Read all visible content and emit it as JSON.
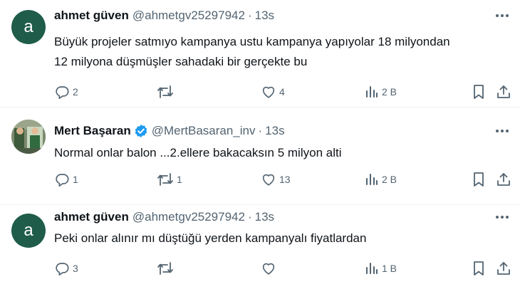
{
  "tweets": [
    {
      "avatar_letter": "a",
      "name": "ahmet güven",
      "handle": "@ahmetgv25297942",
      "separator": "·",
      "time": "13s",
      "text_lines": [
        "Büyük projeler satmıyo kampanya ustu kampanya yapıyolar 18 milyondan",
        "12 milyona düşmüşler sahadaki bir gerçekte bu"
      ],
      "replies": "2",
      "retweets": "",
      "likes": "4",
      "views": "2 B"
    },
    {
      "avatar_letter": "",
      "name": "Mert Başaran",
      "verified": true,
      "handle": "@MertBasaran_inv",
      "separator": "·",
      "time": "13s",
      "text_lines": [
        "Normal onlar balon ...2.ellere bakacaksın 5 milyon alti"
      ],
      "replies": "1",
      "retweets": "1",
      "likes": "13",
      "views": "2 B"
    },
    {
      "avatar_letter": "a",
      "name": "ahmet güven",
      "handle": "@ahmetgv25297942",
      "separator": "·",
      "time": "13s",
      "text_lines": [
        "Peki onlar alınır mı düştüğü yerden kampanyalı fiyatlardan"
      ],
      "replies": "3",
      "retweets": "",
      "likes": "",
      "views": "1 B"
    }
  ],
  "icons": {
    "more": "more-dots-icon",
    "reply": "reply-bubble-icon",
    "retweet": "retweet-icon",
    "like": "heart-icon",
    "views": "bar-chart-icon",
    "bookmark": "bookmark-icon",
    "share": "share-icon",
    "verified": "verified-badge-icon"
  },
  "colors": {
    "text": "#0f1419",
    "secondary": "#536471",
    "verified": "#1d9bf0",
    "avatar_bg": "#1f5c4a",
    "divider": "#eff3f4"
  }
}
